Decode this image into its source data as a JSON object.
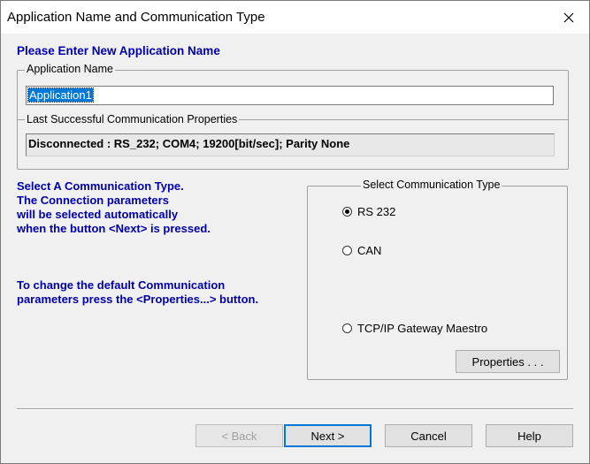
{
  "window": {
    "title": "Application Name and Communication Type"
  },
  "heading": "Please Enter New Application Name",
  "app_name_group": {
    "legend": "Application Name",
    "value": "Application1"
  },
  "last_comm_group": {
    "legend": "Last Successful Communication  Properties",
    "status": "Disconnected : RS_232; COM4; 19200[bit/sec]; Parity None"
  },
  "info": {
    "lines1": [
      "Select A Communication Type.",
      "The Connection parameters",
      "will be selected automatically",
      "when the button <Next> is pressed."
    ],
    "lines2": [
      "To change the default Communication",
      "parameters press the <Properties...> button."
    ]
  },
  "comm_type_group": {
    "legend": "Select Communication Type",
    "options": [
      {
        "label": "RS 232",
        "checked": true
      },
      {
        "label": "CAN",
        "checked": false
      },
      {
        "label": "TCP/IP Gateway  Maestro",
        "checked": false
      }
    ],
    "properties_label": "Properties . . ."
  },
  "buttons": {
    "back": "< Back",
    "next": "Next >",
    "cancel": "Cancel",
    "help": "Help"
  },
  "colors": {
    "accent_text": "#0000a8",
    "selection": "#0078d7"
  }
}
